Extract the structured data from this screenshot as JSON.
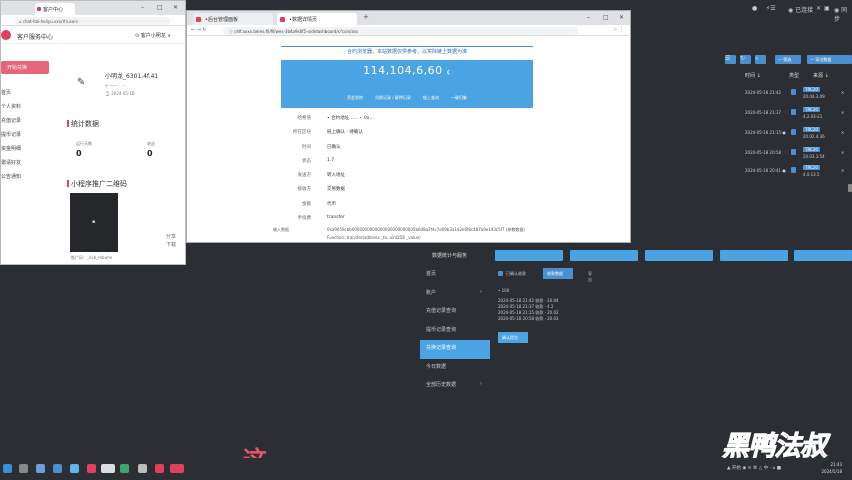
{
  "left_window": {
    "tab_title": "客户中心",
    "address": "⌂ chat-hbi-heliyu.xxx/#/users",
    "brand": "客户服务中心",
    "user_label": "⊙ 客户小明龙 ∨",
    "primary_button": "开始兑换",
    "menu": [
      "首页",
      "个人资料",
      "充值记录",
      "提币记录",
      "资金明细",
      "邀请好友",
      "公告通知"
    ],
    "user_id": "小明龙_6301.4f.41",
    "info_line1": "⚲ —— 　···",
    "info_line2": "⌚ 2024-05-18",
    "section_stats": "统计数据",
    "stat1_label": "运行天数",
    "stat1_value": "0",
    "stat2_label": "收益",
    "stat2_value": "0",
    "section_qr": "小程序推广二维码",
    "qr_glyph": "▪",
    "side_link1": "分享",
    "side_link2": "下载",
    "footer": "推广码：_ilxb_mbuhe"
  },
  "mid_window": {
    "tabs": [
      "•后台管理面板",
      "•数据详情页"
    ],
    "address": "ⓘ chlf.axxx.beres.fil/fil/wes-3b4a9s6f5-x/d/dashboard/s?coin/ass",
    "notice": "合约浏览器，本站数据仅供参考，以实际链上数据为准",
    "amount": "114,104,6,60",
    "amount_unit": "¢",
    "banner_links": [
      "资金划转",
      "兑换记录 / 解押记录",
      "链上查询",
      "一键归集"
    ],
    "rows": [
      {
        "k": "哈希值",
        "v": "• 合约地址……・ 0x…"
      },
      {
        "k": "所在区块",
        "v": "链上确认 · 待确认"
      },
      {
        "k": "时间",
        "v": "已确认"
      },
      {
        "k": "状态",
        "v": "1.7"
      },
      {
        "k": "发送方",
        "v": "转入地址"
      },
      {
        "k": "接收方",
        "v": "交易数据"
      },
      {
        "k": "金额",
        "v": "代币"
      },
      {
        "k": "手续费",
        "v": "transfer"
      }
    ],
    "last_key": "输入数据",
    "last_value1": "0xa9059cbb0000000000000000000000005b6d8a2f4c7e09b3a1d2e6f8c4b7a9e1d3c5f7 (参数数据)",
    "last_value2": "Function: transfer(address _to, uint256 _value)"
  },
  "tray_top": {
    "items": [
      "●",
      "⚡☰",
      "◉ 已连接",
      "✕",
      "▣",
      "◉ 同步"
    ]
  },
  "right_panel": {
    "buttons": [
      "☰",
      "↻",
      "⌕"
    ],
    "wide_buttons": [
      "— 筛选",
      "— 导出数据"
    ],
    "columns": [
      "时间 ↓",
      "类型",
      "来源 ↓"
    ],
    "rows": [
      {
        "date": "2024-05-18 21:42",
        "tag": "TRC20",
        "sub": "20.04.3.09",
        "x": "✕"
      },
      {
        "date": "2024-05-18 21:37",
        "tag": "TRC20",
        "sub": "4.2.03-21",
        "x": "✕"
      },
      {
        "date": "2024-05-18 21:15 ●",
        "tag": "TRC20",
        "sub": "20.02.4.36",
        "x": "✕"
      },
      {
        "date": "2024-05-18 20:58",
        "tag": "TRC20",
        "sub": "20.03.3.54",
        "x": "✕"
      },
      {
        "date": "2024-05-18 20:41 ●",
        "tag": "TRC20",
        "sub": "4.0.13.5",
        "x": "✕"
      }
    ]
  },
  "bottom_panel": {
    "title": "数据统计与服务",
    "nav": [
      "首页",
      "账户",
      "充值记录查询",
      "提币记录查询",
      "兑换记录查询",
      "今日数据",
      "全部历史数据"
    ],
    "nav_arrows": [
      "›",
      "›"
    ],
    "sub_label": "已确认收款",
    "sub_button": "收款数据",
    "sub_label2": "导出",
    "value": "• 100",
    "lines": [
      "2024-05-18 21:42 收款 · 20.04",
      "2024-05-18 21:37 收款 · 4.2",
      "2024-05-18 21:15 收款 · 20.02",
      "2024-05-18 20:58 收款 · 20.03"
    ],
    "action_button": "确认提交"
  },
  "overlay": {
    "big_char": "这",
    "watermark": "黑鸭法叔"
  },
  "taskbar": {
    "tray": "▲ 开始 ◉ ≡ ⌘ △ 中 · ⌂ ■",
    "time": "21:43",
    "date": "2024/5/18"
  },
  "colors": {
    "accent_blue": "#4aa3e3",
    "accent_red": "#e0405a",
    "desktop": "#2b2e33"
  }
}
